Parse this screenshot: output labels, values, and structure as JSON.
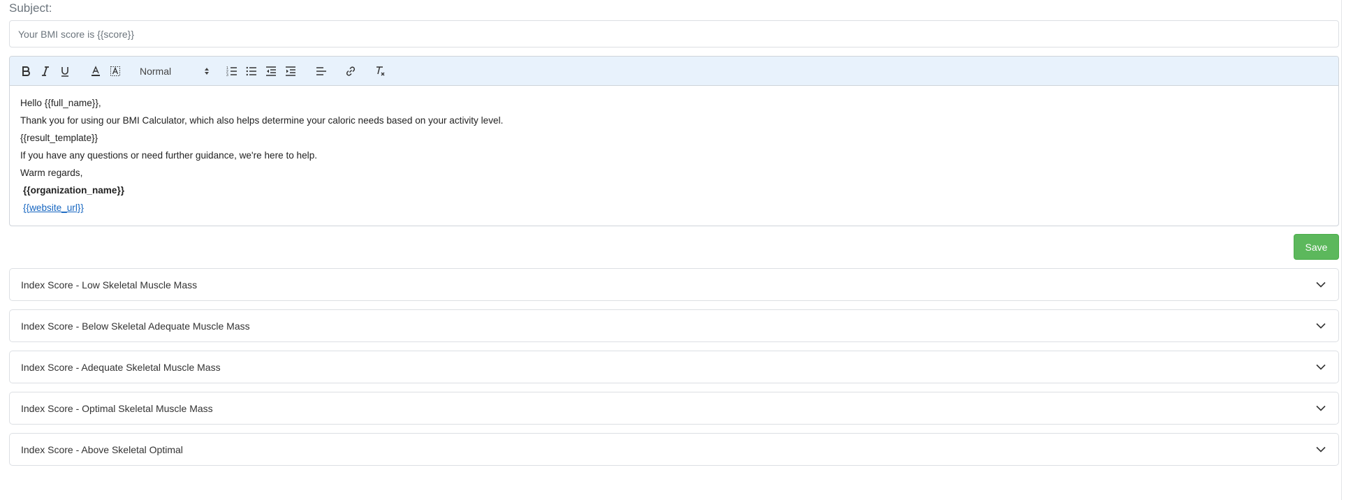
{
  "subject": {
    "label": "Subject:",
    "value": "Your BMI score is {{score}}"
  },
  "toolbar": {
    "buttons": [
      {
        "name": "bold-button",
        "icon": "bold-icon"
      },
      {
        "name": "italic-button",
        "icon": "italic-icon"
      },
      {
        "name": "underline-button",
        "icon": "underline-icon"
      },
      {
        "name": "text-color-button",
        "icon": "text-color-icon"
      },
      {
        "name": "background-color-button",
        "icon": "highlight-icon"
      },
      {
        "name": "ordered-list-button",
        "icon": "ordered-list-icon"
      },
      {
        "name": "bullet-list-button",
        "icon": "bullet-list-icon"
      },
      {
        "name": "outdent-button",
        "icon": "outdent-icon"
      },
      {
        "name": "indent-button",
        "icon": "indent-icon"
      },
      {
        "name": "align-button",
        "icon": "align-left-icon"
      },
      {
        "name": "link-button",
        "icon": "link-icon"
      },
      {
        "name": "clear-format-button",
        "icon": "clear-format-icon"
      }
    ],
    "format_select": "Normal"
  },
  "editor": {
    "lines": [
      "Hello {{full_name}},",
      "Thank you for using our BMI Calculator, which also helps determine your caloric needs based on your activity level.",
      "{{result_template}}",
      "If you have any questions or need further guidance, we're here to help.",
      "Warm regards,"
    ],
    "org_name": "{{organization_name}}",
    "website_url": "{{website_url}}"
  },
  "save_label": "Save",
  "accordions": [
    "Index Score - Low Skeletal Muscle Mass",
    "Index Score - Below Skeletal Adequate Muscle Mass",
    "Index Score - Adequate Skeletal Muscle Mass",
    "Index Score - Optimal Skeletal Muscle Mass",
    "Index Score - Above Skeletal Optimal"
  ],
  "colors": {
    "toolbar_bg": "#e8f2fc",
    "save_green": "#5cb85c",
    "link_blue": "#1565c0"
  }
}
